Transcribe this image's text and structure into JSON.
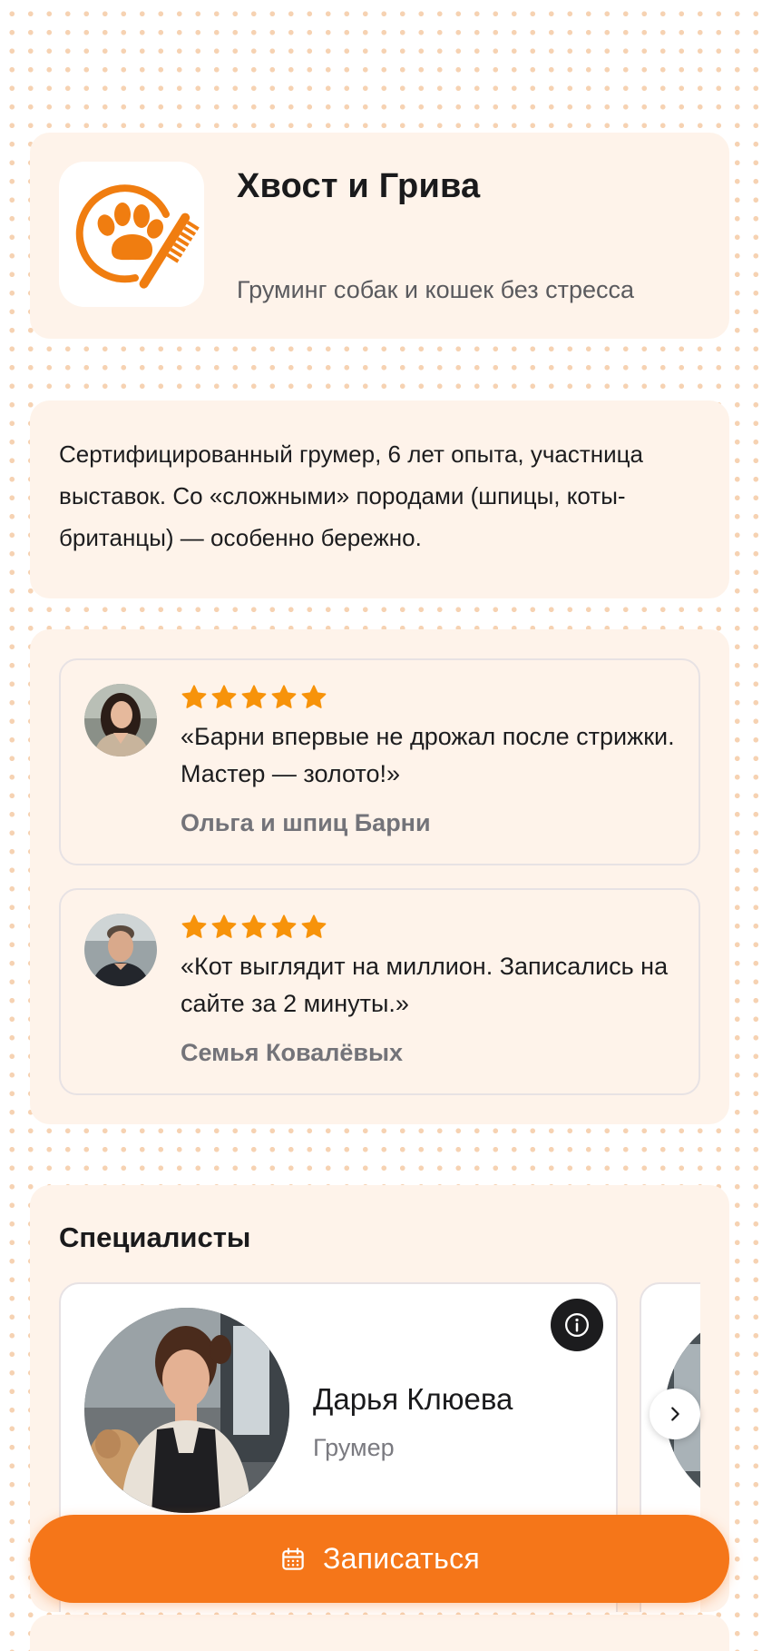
{
  "colors": {
    "accent": "#f57619",
    "card_background": "#fef3ea",
    "star": "#f7930a",
    "dots": "#f6d2b2"
  },
  "header": {
    "logo_icon": "paw-comb-icon",
    "title": "Хвост и Грива",
    "tagline": "Груминг собак и кошек без стресса"
  },
  "about": {
    "text": "Сертифицированный грумер, 6 лет опыта, участница выставок. Со «сложными» породами (шпицы, коты-британцы) — особенно бережно."
  },
  "reviews": [
    {
      "rating": 5,
      "text": "«Барни впервые не дрожал после стрижки. Мастер — золото!»",
      "author": "Ольга и шпиц Барни"
    },
    {
      "rating": 5,
      "text": "«Кот выглядит на миллион. Записались на сайте за 2 минуты.»",
      "author": "Семья Ковалёвых"
    }
  ],
  "specialists": {
    "title": "Специалисты",
    "items": [
      {
        "name": "Дарья Клюева",
        "role": "Грумер"
      }
    ],
    "info_icon": "info-icon",
    "next_icon": "chevron-right-icon"
  },
  "booking": {
    "label": "Записаться",
    "icon": "calendar-icon"
  }
}
